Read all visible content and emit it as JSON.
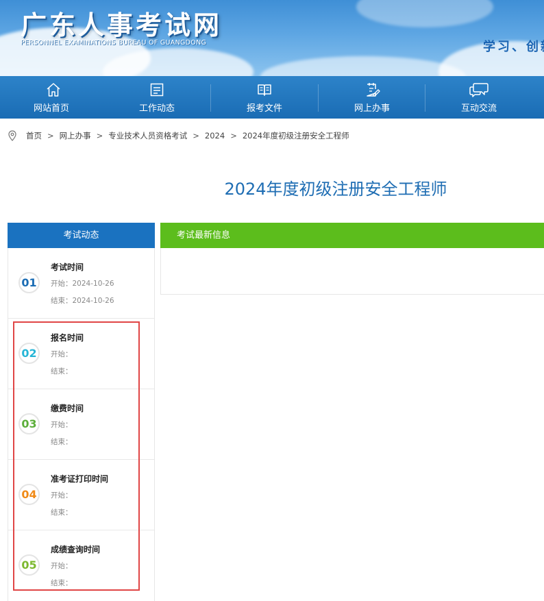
{
  "header": {
    "site_title": "广东人事考试网",
    "site_subtitle": "PERSONNEL EXAMINATIONS BUREAU OF GUANGDONG",
    "slogan": "学习、创新"
  },
  "nav": {
    "items": [
      {
        "label": "网站首页",
        "icon": "home-icon"
      },
      {
        "label": "工作动态",
        "icon": "news-icon"
      },
      {
        "label": "报考文件",
        "icon": "book-icon"
      },
      {
        "label": "网上办事",
        "icon": "clipboard-edit-icon"
      },
      {
        "label": "互动交流",
        "icon": "chat-icon"
      }
    ]
  },
  "breadcrumb": {
    "icon": "location-pin-icon",
    "items": [
      "首页",
      "网上办事",
      "专业技术人员资格考试",
      "2024",
      "2024年度初级注册安全工程师"
    ],
    "separator": ">"
  },
  "page": {
    "title": "2024年度初级注册安全工程师"
  },
  "left_panel": {
    "header": "考试动态",
    "items": [
      {
        "num": "01",
        "title": "考试时间",
        "start": "开始：2024-10-26",
        "end": "结束：2024-10-26",
        "color": "#1a6cb4"
      },
      {
        "num": "02",
        "title": "报名时间",
        "start": "开始：",
        "end": "结束：",
        "color": "#26b5d6"
      },
      {
        "num": "03",
        "title": "缴费时间",
        "start": "开始：",
        "end": "结束：",
        "color": "#5cae3a"
      },
      {
        "num": "04",
        "title": "准考证打印时间",
        "start": "开始：",
        "end": "结束：",
        "color": "#f08a17"
      },
      {
        "num": "05",
        "title": "成绩查询时间",
        "start": "开始：",
        "end": "结束：",
        "color": "#7cb82f"
      }
    ]
  },
  "right_panel": {
    "header": "考试最新信息"
  },
  "colors": {
    "nav_bg": "#1a6cb4",
    "left_header_bg": "#1a72c0",
    "right_header_bg": "#5cbd1c",
    "title_color": "#1e6db3",
    "highlight_border": "#e04545"
  }
}
